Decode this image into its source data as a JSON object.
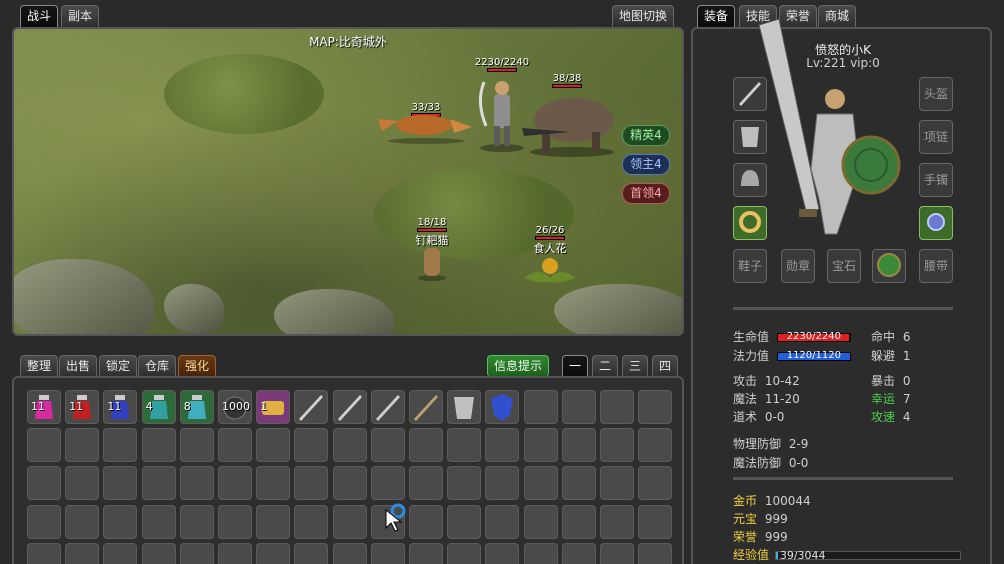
{
  "top_tabs": {
    "battle": "战斗",
    "dungeon": "副本",
    "map_switch": "地图切换"
  },
  "map": {
    "title": "MAP:比奇城外",
    "player": {
      "hp": "2230/2240",
      "hp_fraction": 0.995
    },
    "units": [
      {
        "hp": "33/33",
        "name": "劲狐",
        "hp_fraction": 1.0
      },
      {
        "hp": "38/38",
        "name": "",
        "hp_fraction": 1.0
      },
      {
        "hp": "18/18",
        "name": "钉耙猫",
        "hp_fraction": 1.0
      },
      {
        "hp": "26/26",
        "name": "食人花",
        "hp_fraction": 1.0
      }
    ],
    "side_buttons": {
      "elite": "精英4",
      "lord": "领主4",
      "boss": "首领4"
    }
  },
  "inventory": {
    "tabs": {
      "sort": "整理",
      "sell": "出售",
      "lock": "锁定",
      "warehouse": "仓库",
      "enhance": "强化"
    },
    "info_button": "信息提示",
    "pages": [
      "一",
      "二",
      "三",
      "四"
    ],
    "item_counts": [
      "11",
      "11",
      "11",
      "4",
      "8",
      "1000",
      "1"
    ]
  },
  "char_tabs": {
    "equip": "装备",
    "skill": "技能",
    "honor": "荣誉",
    "shop": "商城"
  },
  "character": {
    "name": "愤怒的小K",
    "level_line": "Lv:221 vip:0",
    "equip_labels": {
      "helmet": "头盔",
      "necklace": "项链",
      "bracelet": "手镯",
      "boots": "鞋子",
      "medal": "勋章",
      "gem": "宝石",
      "belt": "腰带"
    },
    "stats": {
      "hp_label": "生命值",
      "hp": "2230/2240",
      "hp_fraction": 0.995,
      "mp_label": "法力值",
      "mp": "1120/1120",
      "mp_fraction": 1.0,
      "hit_label": "命中",
      "hit": "6",
      "dodge_label": "躲避",
      "dodge": "1",
      "atk_label": "攻击",
      "atk": "10-42",
      "crit_label": "暴击",
      "crit": "0",
      "magic_label": "魔法",
      "magic": "11-20",
      "luck_label": "幸运",
      "luck": "7",
      "tao_label": "道术",
      "tao": "0-0",
      "speed_label": "攻速",
      "speed": "4",
      "pdef_label": "物理防御",
      "pdef": "2-9",
      "mdef_label": "魔法防御",
      "mdef": "0-0",
      "gold_label": "金币",
      "gold": "100044",
      "yuanbao_label": "元宝",
      "yuanbao": "999",
      "honor_label": "荣誉",
      "honor": "999",
      "exp_label": "经验值",
      "exp": "39/3044",
      "exp_fraction": 0.013
    }
  }
}
